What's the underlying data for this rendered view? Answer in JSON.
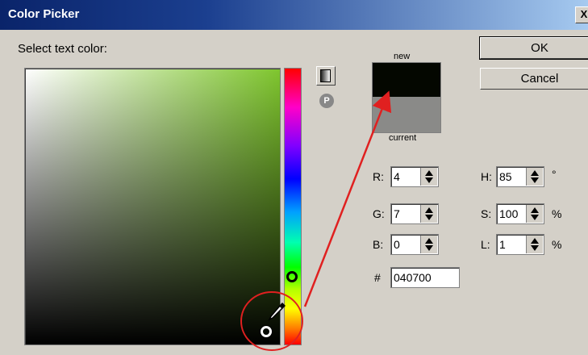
{
  "window": {
    "title": "Color Picker",
    "close_label": "X"
  },
  "picker": {
    "prompt": "Select text color:"
  },
  "preview": {
    "new_label": "new",
    "current_label": "current",
    "new_color": "#040700",
    "current_color": "#8a8a88"
  },
  "buttons": {
    "ok": "OK",
    "cancel": "Cancel"
  },
  "rgb": {
    "r_label": "R:",
    "r_value": "4",
    "g_label": "G:",
    "g_value": "7",
    "b_label": "B:",
    "b_value": "0"
  },
  "hsl": {
    "h_label": "H:",
    "h_value": "85",
    "h_unit": "°",
    "s_label": "S:",
    "s_value": "100",
    "s_unit": "%",
    "l_label": "L:",
    "l_value": "1",
    "l_unit": "%"
  },
  "hex": {
    "label": "#",
    "value": "040700"
  },
  "colors": {
    "annotation": "#e02020",
    "title_bar": "#0a246a"
  }
}
